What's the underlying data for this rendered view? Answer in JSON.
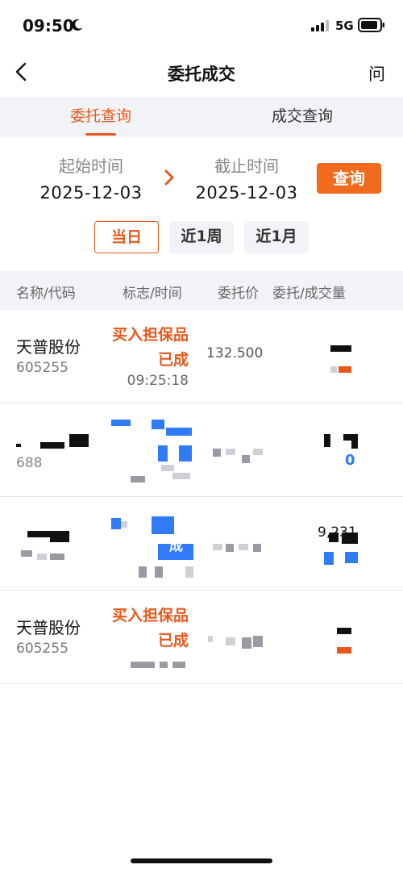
{
  "status_bar": {
    "time": "09:50",
    "network": "5G",
    "icons": [
      "moon-icon",
      "signal-icon",
      "battery-icon"
    ]
  },
  "nav": {
    "title": "委托成交",
    "help": "问",
    "back_icon": "chevron-left-icon"
  },
  "tabs": [
    {
      "label": "委托查询",
      "active": true
    },
    {
      "label": "成交查询",
      "active": false
    }
  ],
  "date_range": {
    "start_label": "起始时间",
    "start_value": "2025-12-03",
    "end_label": "截止时间",
    "end_value": "2025-12-03",
    "query_label": "查询"
  },
  "ranges": [
    {
      "label": "当日",
      "active": true
    },
    {
      "label": "近1周",
      "active": false
    },
    {
      "label": "近1月",
      "active": false
    }
  ],
  "table": {
    "headers": [
      "名称/代码",
      "标志/时间",
      "委托价",
      "委托/成交量"
    ],
    "rows": [
      {
        "name": "天普股份",
        "code": "605255",
        "flag": "买入担保品",
        "status": "已成",
        "time": "09:25:18",
        "price": "132.500"
      },
      {
        "code_partial": "688",
        "qty_partial": "0"
      },
      {
        "status_partial": "成",
        "qty_partial": "9,231"
      },
      {
        "name": "天普股份",
        "code": "605255",
        "flag": "买入担保品",
        "status": "已成"
      }
    ]
  },
  "colors": {
    "accent": "#e8581a",
    "query_button": "#f26a1b",
    "link_blue": "#2f7cf6",
    "section_bg": "#f2f3f7"
  }
}
